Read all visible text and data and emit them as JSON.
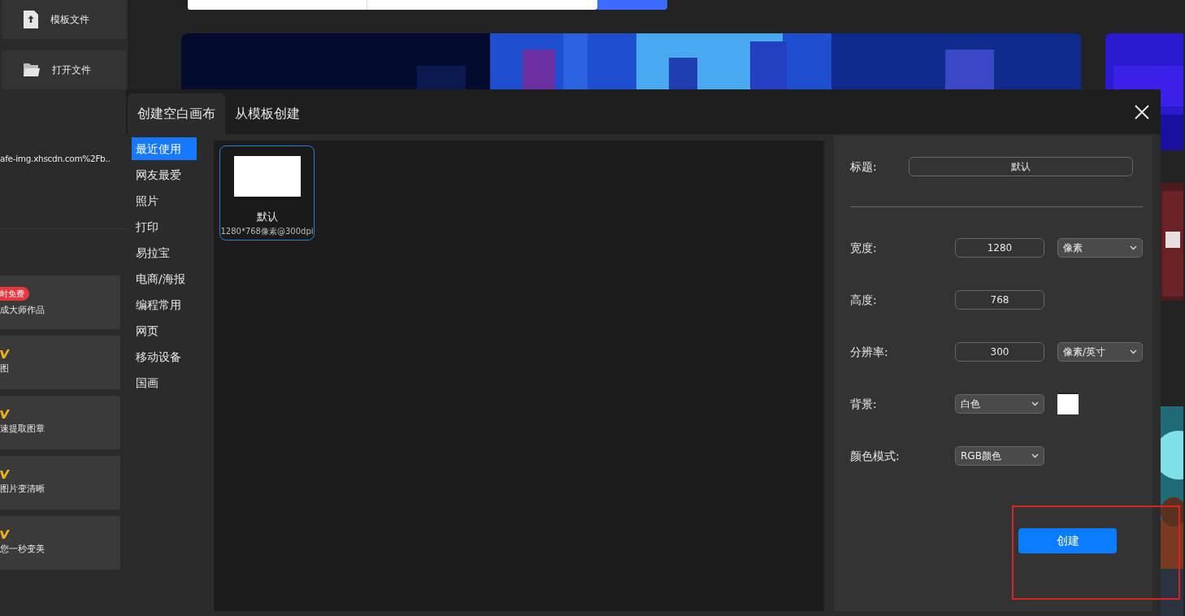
{
  "sidebar": {
    "actions": [
      {
        "label": "模板文件"
      },
      {
        "label": "打开文件"
      }
    ],
    "recent_file": "afe-img.xhscdn.com%2Fb..",
    "features": [
      {
        "kind": "badge",
        "badge": "时免费",
        "label": "成大师作品"
      },
      {
        "kind": "vip",
        "label": "图"
      },
      {
        "kind": "vip",
        "label": "速提取图章"
      },
      {
        "kind": "vip",
        "label": "图片变清晰"
      },
      {
        "kind": "vip",
        "label": "您一秒变美"
      }
    ]
  },
  "dialog": {
    "tabs": [
      {
        "label": "创建空白画布",
        "selected": true
      },
      {
        "label": "从模板创建",
        "selected": false
      }
    ],
    "categories": [
      {
        "label": "最近使用",
        "selected": true
      },
      {
        "label": "网友最爱",
        "selected": false
      },
      {
        "label": "照片",
        "selected": false
      },
      {
        "label": "打印",
        "selected": false
      },
      {
        "label": "易拉宝",
        "selected": false
      },
      {
        "label": "电商/海报",
        "selected": false
      },
      {
        "label": "编程常用",
        "selected": false
      },
      {
        "label": "网页",
        "selected": false
      },
      {
        "label": "移动设备",
        "selected": false
      },
      {
        "label": "国画",
        "selected": false
      }
    ],
    "templates": [
      {
        "name": "默认",
        "size": "1280*768像素@300dpi",
        "selected": true
      }
    ],
    "form": {
      "title": {
        "label": "标题:",
        "value": "默认"
      },
      "rows": [
        {
          "kind": "input",
          "label": "宽度:",
          "value": "1280",
          "unit": "像素"
        },
        {
          "kind": "input",
          "label": "高度:",
          "value": "768"
        },
        {
          "kind": "input",
          "label": "分辨率:",
          "value": "300",
          "unit": "像素/英寸"
        },
        {
          "kind": "select",
          "label": "背景:",
          "value": "白色",
          "swatch": true
        },
        {
          "kind": "select",
          "label": "颜色模式:",
          "value": "RGB颜色"
        }
      ]
    },
    "create_button": "创建"
  }
}
